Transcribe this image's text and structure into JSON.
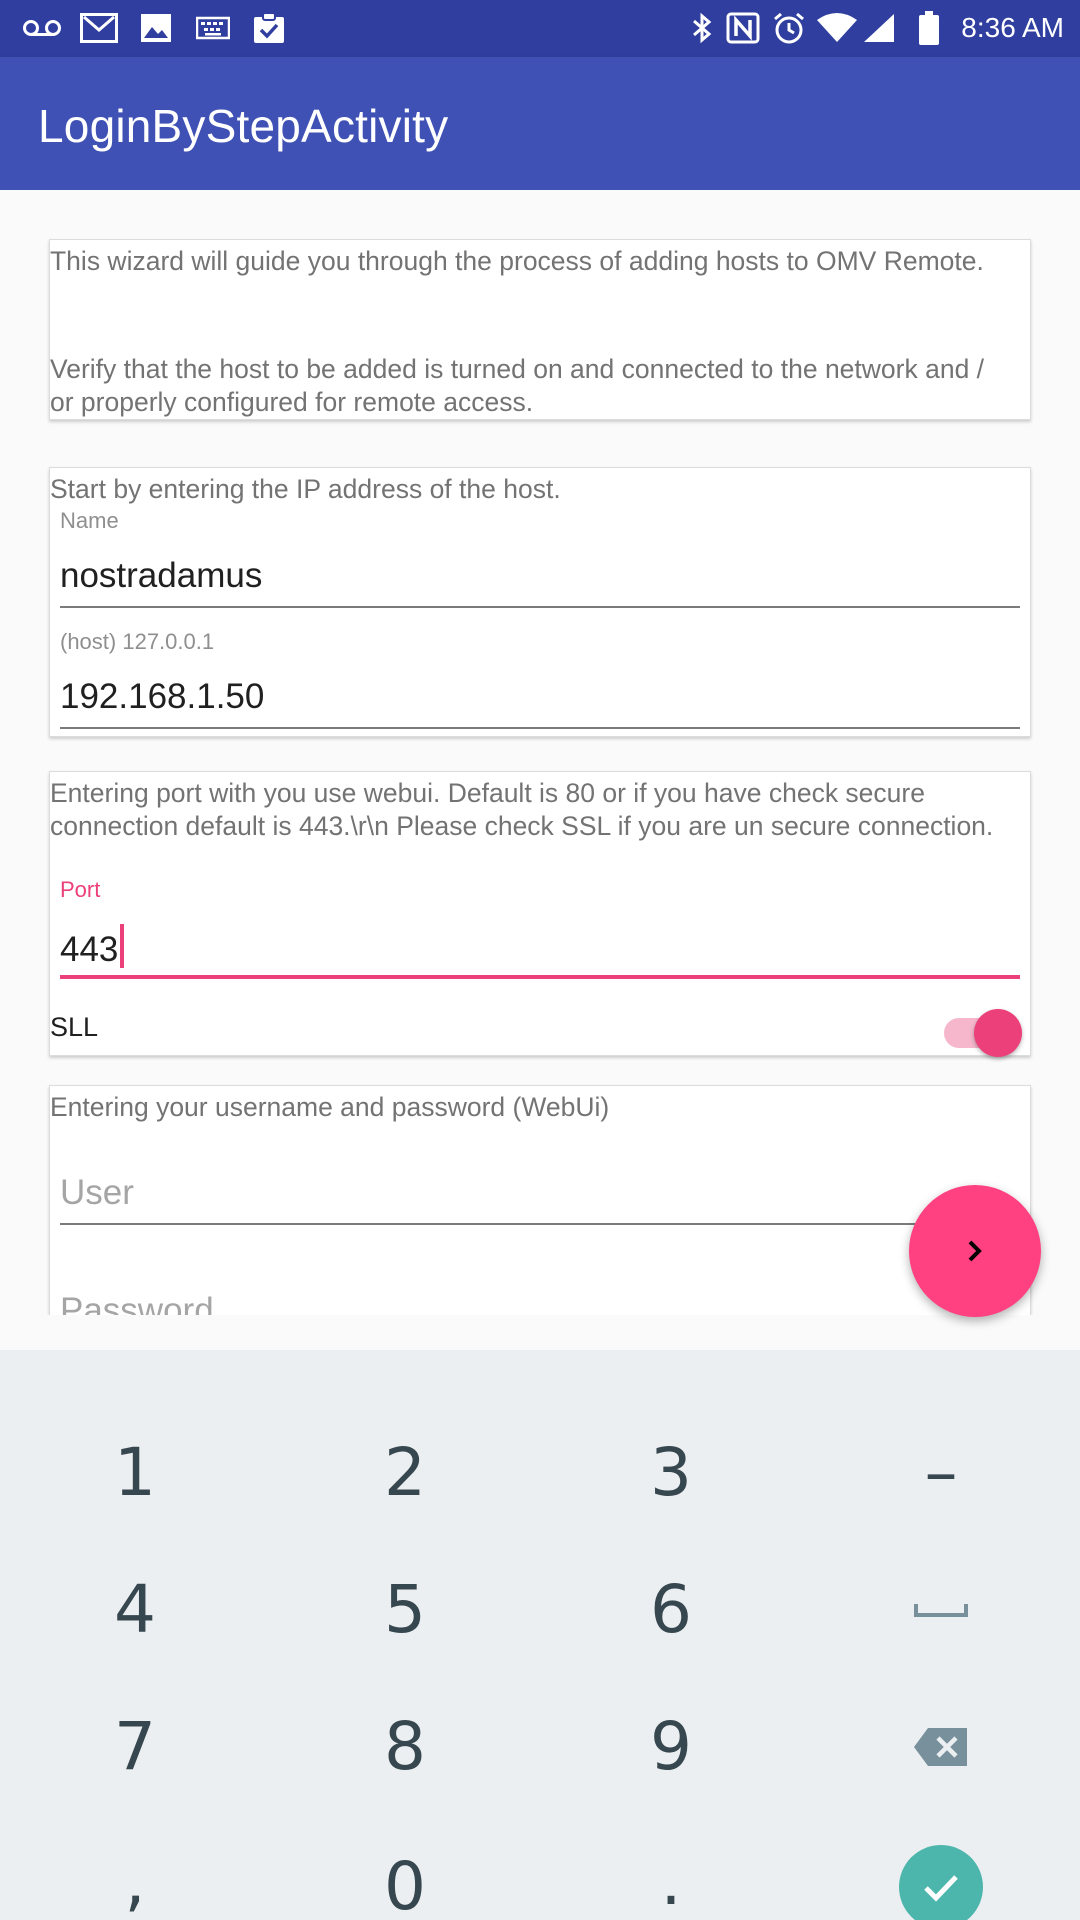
{
  "status_bar": {
    "time": "8:36 AM",
    "left_icons": [
      "voicemail-icon",
      "gmail-icon",
      "image-icon",
      "keyboard-icon",
      "clipboard-check-icon"
    ],
    "right_icons": [
      "bluetooth-icon",
      "nfc-icon",
      "alarm-icon",
      "wifi-icon",
      "signal-icon",
      "battery-icon"
    ]
  },
  "app_bar": {
    "title": "LoginByStepActivity"
  },
  "intro_card": {
    "paragraph1": "This wizard will guide you through the process of adding hosts to OMV Remote.",
    "paragraph2": "Verify that the host to be added is turned on and connected to the network and / or properly configured for remote access."
  },
  "host_card": {
    "intro": "Start by entering the IP address of the host.",
    "name_label": "Name",
    "name_value": "nostradamus",
    "host_label": "(host) 127.0.0.1",
    "host_value": "192.168.1.50"
  },
  "port_card": {
    "intro": "Entering port with you use webui. Default is 80 or if you have check secure connection default is 443.\\r\\n Please check SSL if you are un secure connection.",
    "port_label": "Port",
    "port_value": "443",
    "sll_label": "SLL",
    "sll_enabled": true
  },
  "credentials_card": {
    "intro": "Entering your username and password (WebUi)",
    "user_placeholder": "User",
    "password_placeholder": "Password"
  },
  "fab": {
    "icon": "chevron-right-icon",
    "color": "#ff4081"
  },
  "keyboard": {
    "keys": [
      "1",
      "2",
      "3",
      "–",
      "4",
      "5",
      "6",
      "␣",
      "7",
      "8",
      "9",
      "⌫",
      ",",
      "0",
      ".",
      "✓"
    ]
  },
  "colors": {
    "status_bar": "#303f9f",
    "app_bar": "#3f51b5",
    "accent": "#ec407a",
    "done_key": "#4db6ac"
  }
}
